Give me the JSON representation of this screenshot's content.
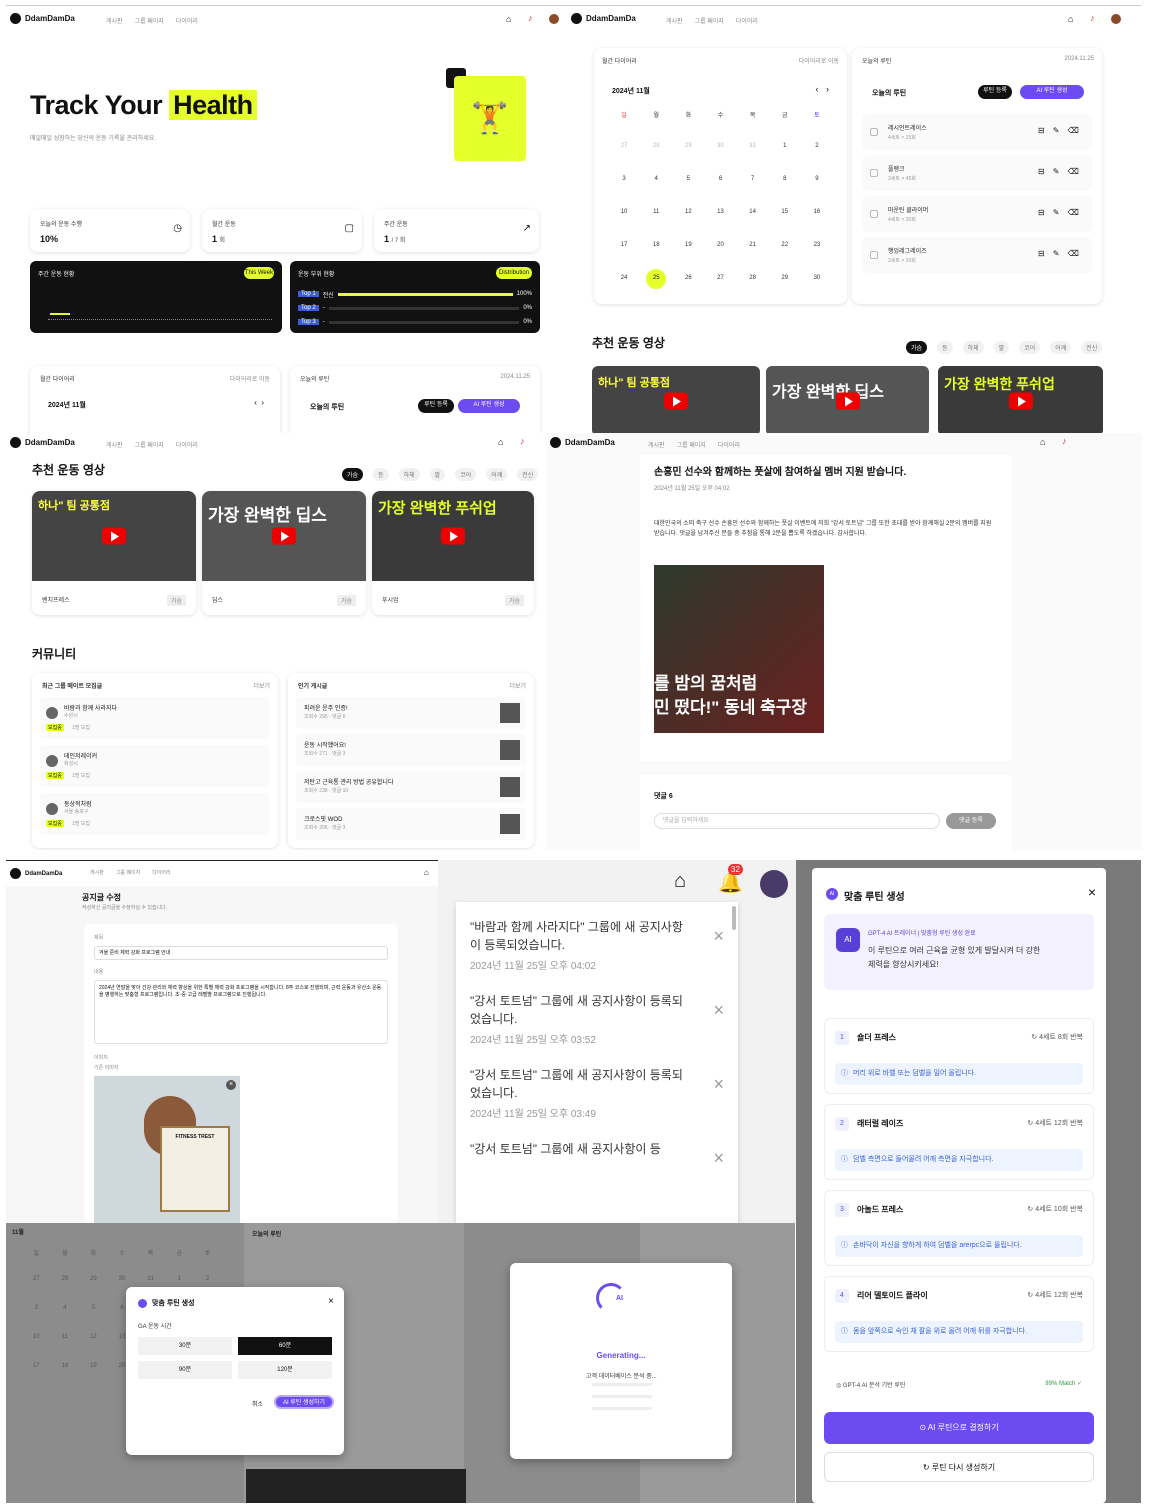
{
  "app": {
    "logo": "DdamDamDa",
    "nav": [
      "게시판",
      "그룹 페이지",
      "다이어리"
    ]
  },
  "hero": {
    "title_a": "Track Your",
    "title_b": "Health",
    "subtitle": "매일매일 성장하는 당신의 운동 기록을 관리하세요."
  },
  "stats": [
    {
      "label": "오늘의 운동 수행",
      "value": "10%",
      "icon": "clock-icon"
    },
    {
      "label": "월간 운동",
      "value": "1",
      "unit": "회",
      "icon": "calendar-icon"
    },
    {
      "label": "주간 운동",
      "value": "1",
      "unit": "/ 7 회",
      "icon": "trend-icon"
    }
  ],
  "weekly_chart": {
    "title": "주간 운동 현황",
    "badge": "This Week"
  },
  "body_parts": {
    "title": "운동 부위 현황",
    "badge": "Distribution",
    "rows": [
      {
        "tag": "Top 1",
        "name": "전신",
        "pct": "100%",
        "fill": 1.0
      },
      {
        "tag": "Top 2",
        "name": "-",
        "pct": "0%",
        "fill": 0
      },
      {
        "tag": "Top 3",
        "name": "-",
        "pct": "0%",
        "fill": 0
      }
    ]
  },
  "diary": {
    "title": "월간 다이어리",
    "link": "다이어리로 이동",
    "month": "2024년 11월",
    "weekdays": [
      "일",
      "월",
      "화",
      "수",
      "목",
      "금",
      "토"
    ],
    "days": [
      "27",
      "28",
      "29",
      "30",
      "31",
      "1",
      "2",
      "3",
      "4",
      "5",
      "6",
      "7",
      "8",
      "9",
      "10",
      "11",
      "12",
      "13",
      "14",
      "15",
      "16",
      "17",
      "18",
      "19",
      "20",
      "21",
      "22",
      "23",
      "24",
      "25",
      "26",
      "27",
      "28",
      "29",
      "30"
    ],
    "today": "25"
  },
  "routine": {
    "title": "오늘의 루틴",
    "date": "2024.11.25",
    "heading": "오늘의 루틴",
    "add_btn": "루틴 등록",
    "ai_btn": "AI 루틴 생성",
    "items": [
      {
        "name": "레시언트레이스",
        "sub": "4세트 × 15회"
      },
      {
        "name": "플랭크",
        "sub": "3세트 × 45회"
      },
      {
        "name": "마운틴 클라이머",
        "sub": "4세트 × 20회"
      },
      {
        "name": "행잉레그레이즈",
        "sub": "3세트 × 10회"
      }
    ]
  },
  "videos": {
    "title": "추천 운동 영상",
    "filters": [
      "가슴",
      "등",
      "하체",
      "팔",
      "코어",
      "어깨",
      "전신"
    ],
    "items": [
      {
        "thumb": "하나\" 팀 공통점",
        "label": "벤치프레스",
        "tag": "가슴"
      },
      {
        "thumb": "가장 완벽한 딥스",
        "label": "딥스",
        "tag": "가슴"
      },
      {
        "thumb": "가장 완벽한 푸쉬업",
        "label": "푸시업",
        "tag": "가슴"
      }
    ]
  },
  "community": {
    "title": "커뮤니티",
    "groups_title": "최근 그룹 메이트 모집글",
    "more": "더보기",
    "posts_title": "인기 게시글",
    "groups": [
      {
        "name": "바람과 함께 사라지다",
        "sub": "수원시",
        "tag": "모집중",
        "meta": "1명 모집"
      },
      {
        "name": "데인저레이커",
        "sub": "화성시",
        "tag": "모집중",
        "meta": "1명 모집"
      },
      {
        "name": "동상적처럼",
        "sub": "서울 송파구",
        "tag": "모집중",
        "meta": "1명 모집"
      }
    ],
    "posts": [
      {
        "title": "피려운 운주 인증!",
        "meta": "조회수 295 · 댓글 6"
      },
      {
        "title": "운동 시작했어요!",
        "meta": "조회수 271 · 댓글 3"
      },
      {
        "title": "저탄고 근육통 관리 방법 공유합니다",
        "meta": "조회수 238 · 댓글 10"
      },
      {
        "title": "크로스핏 WOD",
        "meta": "조회수 206 · 댓글 3"
      }
    ]
  },
  "article": {
    "title": "손흥민 선수와 함께하는 풋살에 참여하실 멤버 지원 받습니다.",
    "date": "2024년 11월 25일 오후 04:02",
    "body": "대한민국의 소떠 축구 선수 손흥민 선수와 함께하는 풋살 이벤트에 저희 \"강서 토트넘\" 그룹 또한 초대를 받아 함께해실 2분의 멤버를 지원 받습니다. 댓글을 남겨주신 분들 중 추첨을 통해 2분을 뽑도록 하겠습니다. 감사합니다.",
    "img_line1": "를 밤의 꿈처럼",
    "img_line2": "민 떴다!\" 동네 축구장",
    "comments": "댓글 6",
    "comment_placeholder": "댓글을 입력하세요",
    "comment_btn": "댓글 등록"
  },
  "notice_edit": {
    "title": "공지글 수정",
    "sub": "작성하신 공지글을 수정하실 수 있습니다.",
    "label_title": "제목",
    "value_title": "겨울 준비 체력 강화 프로그램 안내",
    "label_body": "내용",
    "value_body": "2024년 연말을 맞아 건강 관리와 체력 향상을 위한 특별 체력 강화 프로그램을 시작합니다. 8주 코스로 진행되며, 근력 운동과 유산소 운동을 병행하는 맞춤형 프로그램입니다. 초·중·고급 레벨별 프로그램으로 진행됩니다.",
    "label_img": "이미지",
    "img_hint": "기존 이미지",
    "img_text": "FITNESS TREST"
  },
  "notifications": {
    "badge": "32",
    "items": [
      {
        "text": "\"바람과 함께 사라지다\" 그룹에 새 공지사항이 등록되었습니다.",
        "time": "2024년 11월 25일 오후 04:02"
      },
      {
        "text": "\"강서 토트넘\" 그룹에 새 공지사항이 등록되었습니다.",
        "time": "2024년 11월 25일 오후 03:52"
      },
      {
        "text": "\"강서 토트넘\" 그룹에 새 공지사항이 등록되었습니다.",
        "time": "2024년 11월 25일 오후 03:49"
      },
      {
        "text": "\"강서 토트넘\" 그룹에 새 공지사항이 등"
      }
    ]
  },
  "ai_modal": {
    "title": "맞춤 루틴 생성",
    "label": "GA 운동 시간",
    "options": [
      "30분",
      "60분",
      "90분",
      "120분"
    ],
    "selected": "60분",
    "cancel": "취소",
    "submit": "AI 루틴 생성하기"
  },
  "generating": {
    "title": "Generating...",
    "step": "고객 데이터베이스 분석 중..."
  },
  "ai_result": {
    "title": "맞춤 루틴 생성",
    "badge": "AI",
    "trainer": "GPT-4 AI 트레이너",
    "trainer_sub": "맞춤형 루틴 생성 완료",
    "message": "이 루틴으로 여러 근육을 균형 있게 발달시켜 더 강한 체력을 향상시키세요!",
    "exercises": [
      {
        "num": "1",
        "name": "숄더 프레스",
        "sets": "4세트 8회 반복",
        "note": "머리 위로 바벨 또는 덤벨을 밀어 올립니다."
      },
      {
        "num": "2",
        "name": "래터럴 레이즈",
        "sets": "4세트 12회 반복",
        "note": "덤벨 측면으로 들어올려 어깨 측면을 자극합니다."
      },
      {
        "num": "3",
        "name": "아놀드 프레스",
        "sets": "4세트 10회 반복",
        "note": "손바닥이 자신을 향하게 하여 덤벨을 arerpc으로 올립니다."
      },
      {
        "num": "4",
        "name": "리어 델토이드 플라이",
        "sets": "4세트 12회 반복",
        "note": "몸을 앞쪽으로 숙인 채 팔을 위로 올려 어깨 뒤를 자극합니다."
      }
    ],
    "basis": "GPT-4 AI 분석 기반 루틴",
    "match": "99% Match ✓",
    "confirm": "AI 루틴으로 결정하기",
    "regen": "루틴 다시 생성하기"
  },
  "colors": {
    "accent": "#e4ff2a",
    "purple": "#6c4cf0",
    "dark": "#111111"
  }
}
